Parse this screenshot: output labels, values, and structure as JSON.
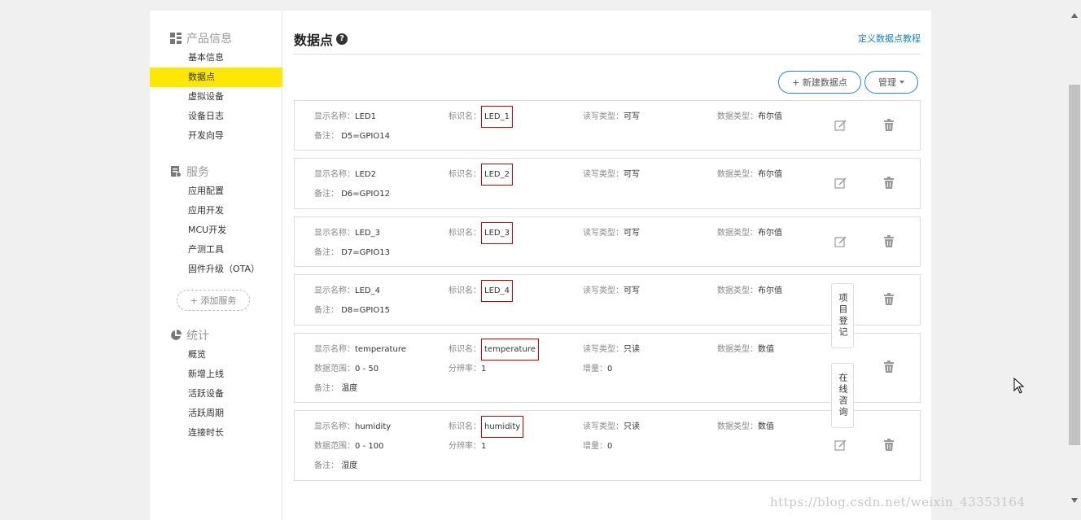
{
  "sidebar": {
    "sections": [
      {
        "title": "产品信息",
        "icon": "grid-icon",
        "items": [
          "基本信息",
          "数据点",
          "虚拟设备",
          "设备日志",
          "开发向导"
        ]
      },
      {
        "title": "服务",
        "icon": "service-icon",
        "items": [
          "应用配置",
          "应用开发",
          "MCU开发",
          "产测工具",
          "固件升级（OTA）"
        ]
      },
      {
        "title": "统计",
        "icon": "pie-chart-icon",
        "items": [
          "概览",
          "新增上线",
          "活跃设备",
          "活跃周期",
          "连接时长"
        ]
      }
    ],
    "active_item": "数据点",
    "add_service_label": "+ 添加服务"
  },
  "header": {
    "title": "数据点",
    "tutorial_link": "定义数据点教程"
  },
  "toolbar": {
    "new_label": "+ 新建数据点",
    "manage_label": "管理"
  },
  "labels": {
    "display_name": "显示名称：",
    "identifier": "标识名：",
    "rw_type": "读写类型：",
    "data_type": "数据类型：",
    "range": "数据范围：",
    "resolution": "分辨率：",
    "increment": "增量：",
    "remark": "备注："
  },
  "datapoints": [
    {
      "display_name": "LED1",
      "identifier": "LED_1",
      "rw": "可写",
      "type": "布尔值",
      "remark": "D5=GPIO14"
    },
    {
      "display_name": "LED2",
      "identifier": "LED_2",
      "rw": "可写",
      "type": "布尔值",
      "remark": "D6=GPIO12"
    },
    {
      "display_name": "LED_3",
      "identifier": "LED_3",
      "rw": "可写",
      "type": "布尔值",
      "remark": "D7=GPIO13"
    },
    {
      "display_name": "LED_4",
      "identifier": "LED_4",
      "rw": "可写",
      "type": "布尔值",
      "remark": "D8=GPIO15"
    },
    {
      "display_name": "temperature",
      "identifier": "temperature",
      "rw": "只读",
      "type": "数值",
      "range": "0 - 50",
      "resolution": "1",
      "increment": "0",
      "remark": "温度"
    },
    {
      "display_name": "humidity",
      "identifier": "humidity",
      "rw": "只读",
      "type": "数值",
      "range": "0 - 100",
      "resolution": "1",
      "increment": "0",
      "remark": "湿度"
    }
  ],
  "float_tabs": [
    "项目登记",
    "在线咨询"
  ],
  "watermark": "https://blog.csdn.net/weixin_43353164"
}
